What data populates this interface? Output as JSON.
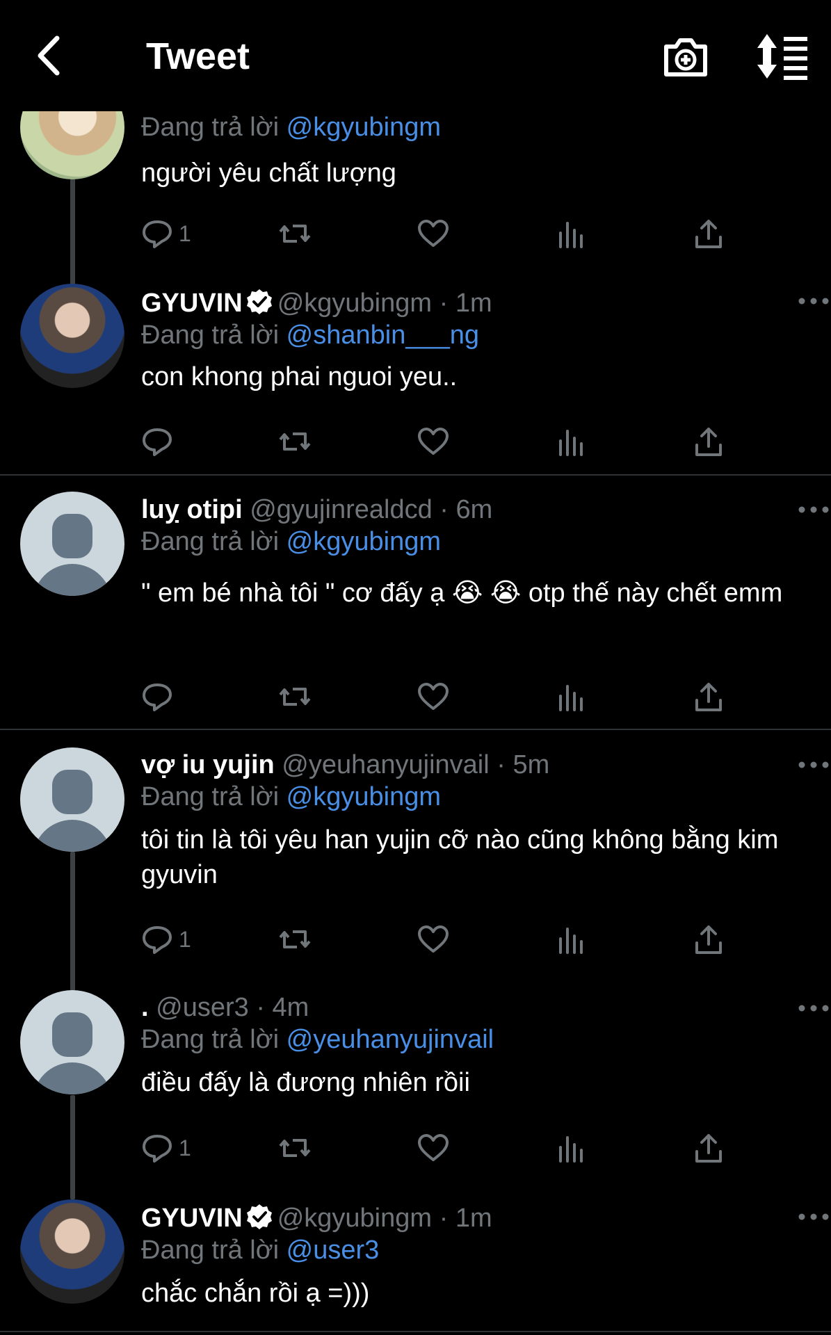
{
  "header": {
    "title": "Tweet",
    "back_icon": "chevron-left-icon",
    "camera_icon": "camera-add-icon",
    "sort_icon": "sort-list-icon"
  },
  "replying_prefix": "Đang trả lời",
  "tweets": [
    {
      "name": "",
      "handle": "",
      "time": "",
      "reply_to": "@kgyubingm",
      "text": "người yêu chất lượng",
      "reply_count": "1"
    },
    {
      "name": "GYUVIN",
      "handle": "@kgyubingm",
      "time": "1m",
      "reply_to": "@shanbin___ng",
      "text": "con khong phai nguoi yeu..",
      "reply_count": ""
    },
    {
      "name": "luỵ otipi",
      "handle": "@gyujinrealdcd",
      "time": "6m",
      "reply_to": "@kgyubingm",
      "text": "\" em bé nhà tôi \" cơ đấy ạ 😭 😭  otp thế này chết emm",
      "reply_count": ""
    },
    {
      "name": "vợ iu yujin",
      "handle": "@yeuhanyujinvail",
      "time": "5m",
      "reply_to": "@kgyubingm",
      "text": "tôi tin là tôi yêu han yujin cỡ nào cũng không bằng kim gyuvin",
      "reply_count": "1"
    },
    {
      "name": ".",
      "handle": "@user3",
      "time": "4m",
      "reply_to": "@yeuhanyujinvail",
      "text": "điều đấy là đương nhiên rồii",
      "reply_count": "1"
    },
    {
      "name": "GYUVIN",
      "handle": "@kgyubingm",
      "time": "1m",
      "reply_to": "@user3",
      "text": "chắc chắn rồi ạ =)))",
      "reply_count": ""
    }
  ],
  "separator_dot": "·",
  "colors": {
    "background": "#000000",
    "mention": "#4a8fe6",
    "muted": "#71767b",
    "text": "#ffffff"
  }
}
